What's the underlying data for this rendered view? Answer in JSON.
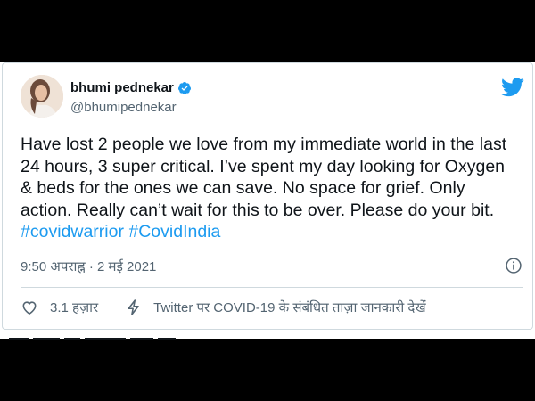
{
  "tweet": {
    "display_name": "bhumi pednekar",
    "handle": "@bhumipednekar",
    "text": "Have lost 2 people we love from my immediate world in the last 24 hours, 3 super critical. I’ve spent my day looking for Oxygen & beds for the ones we can save. No space for grief. Only action. Really can’t wait for this to be over. Please do your bit.",
    "hashtags": [
      "#covidwarrior",
      "#CovidIndia"
    ],
    "timestamp": "9:50 अपराह्न · 2 मई 2021"
  },
  "actions": {
    "like_count": "3.1 हज़ार",
    "info_label": "Twitter पर COVID-19 के संबंधित ताज़ा जानकारी देखें"
  },
  "icons": {
    "verified": "verified-badge-icon",
    "logo": "twitter-bird-icon",
    "info": "info-icon",
    "like": "heart-icon",
    "bolt": "lightning-bolt-icon"
  },
  "colors": {
    "accent": "#1d9bf0",
    "text": "#0f1419",
    "muted": "#536471",
    "border": "#cfd9de",
    "background": "#000000"
  }
}
